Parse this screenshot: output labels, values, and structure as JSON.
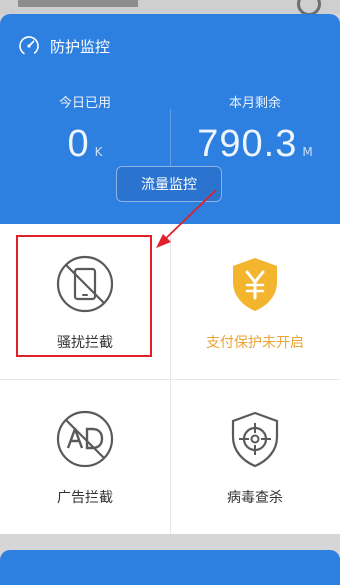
{
  "header": {
    "title": "防护监控",
    "today_used": {
      "label": "今日已用",
      "value": "0",
      "unit": "K"
    },
    "month_remaining": {
      "label": "本月剩余",
      "value": "790.3",
      "unit": "M"
    },
    "traffic_button_label": "流量监控"
  },
  "features": [
    {
      "label": "骚扰拦截",
      "icon": "no-phone-icon"
    },
    {
      "label": "支付保护未开启",
      "icon": "yuan-shield-icon"
    },
    {
      "label": "广告拦截",
      "icon": "no-ad-icon"
    },
    {
      "label": "病毒查杀",
      "icon": "crosshair-shield-icon"
    }
  ],
  "colors": {
    "header_blue": "#2d7fe0",
    "accent_orange": "#e9a436",
    "annotation_red": "#e0202a"
  }
}
